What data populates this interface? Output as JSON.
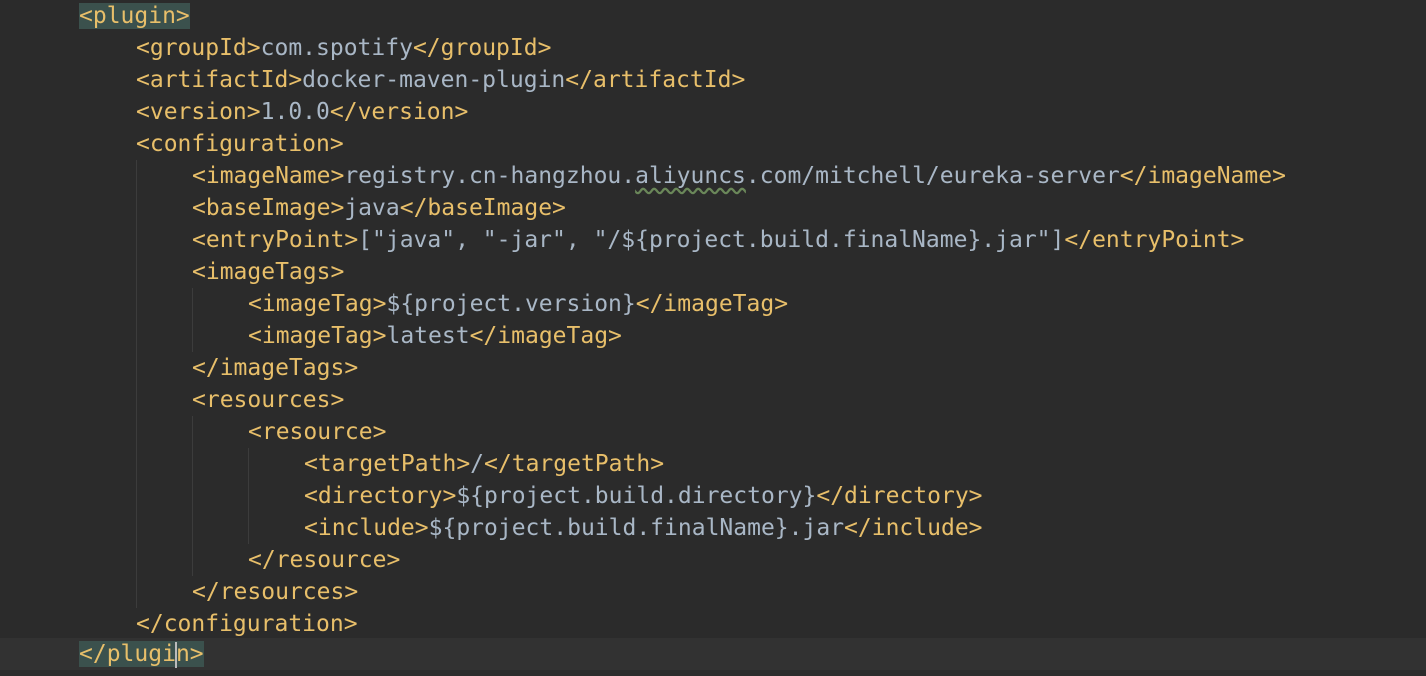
{
  "editor": {
    "lines": [
      {
        "open": "<plugin>"
      },
      {
        "open": "<groupId>",
        "text": "com.spotify",
        "close": "</groupId>"
      },
      {
        "open": "<artifactId>",
        "text": "docker-maven-plugin",
        "close": "</artifactId>"
      },
      {
        "open": "<version>",
        "text": "1.0.0",
        "close": "</version>"
      },
      {
        "open": "<configuration>"
      },
      {
        "open": "<imageName>",
        "text_a": "registry.cn-hangzhou.",
        "text_b": "aliyuncs",
        "text_c": ".com/mitchell/eureka-server",
        "close": "</imageName>"
      },
      {
        "open": "<baseImage>",
        "text": "java",
        "close": "</baseImage>"
      },
      {
        "open": "<entryPoint>",
        "text": "[\"java\", \"-jar\", \"/${project.build.finalName}.jar\"]",
        "close": "</entryPoint>"
      },
      {
        "open": "<imageTags>"
      },
      {
        "open": "<imageTag>",
        "text": "${project.version}",
        "close": "</imageTag>"
      },
      {
        "open": "<imageTag>",
        "text": "latest",
        "close": "</imageTag>"
      },
      {
        "close": "</imageTags>"
      },
      {
        "open": "<resources>"
      },
      {
        "open": "<resource>"
      },
      {
        "open": "<targetPath>",
        "text": "/",
        "close": "</targetPath>"
      },
      {
        "open": "<directory>",
        "text": "${project.build.directory}",
        "close": "</directory>"
      },
      {
        "open": "<include>",
        "text": "${project.build.finalName}.jar",
        "close": "</include>"
      },
      {
        "close": "</resource>"
      },
      {
        "close": "</resources>"
      },
      {
        "close": "</configuration>"
      },
      {
        "close_a": "</plugi",
        "close_b": "n>"
      }
    ]
  },
  "colors": {
    "background": "#2b2b2b",
    "current_line": "#323232",
    "tag": "#e8bf6a",
    "text": "#a9b7c6",
    "tag_highlight": "#3b514d"
  }
}
